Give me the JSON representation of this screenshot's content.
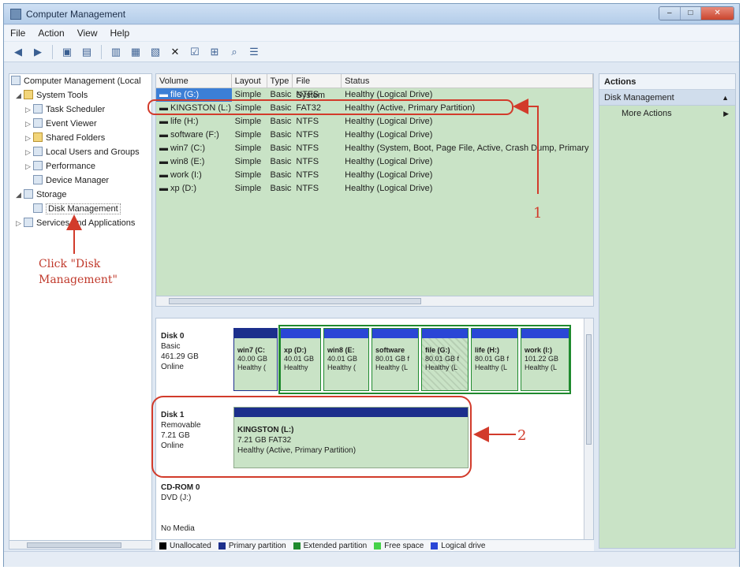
{
  "window": {
    "title": "Computer Management"
  },
  "menu": [
    "File",
    "Action",
    "View",
    "Help"
  ],
  "tree": {
    "root": "Computer Management (Local",
    "items": [
      {
        "label": "System Tools",
        "level": 1
      },
      {
        "label": "Task Scheduler",
        "level": 2
      },
      {
        "label": "Event Viewer",
        "level": 2
      },
      {
        "label": "Shared Folders",
        "level": 2
      },
      {
        "label": "Local Users and Groups",
        "level": 2
      },
      {
        "label": "Performance",
        "level": 2
      },
      {
        "label": "Device Manager",
        "level": 2
      },
      {
        "label": "Storage",
        "level": 1
      },
      {
        "label": "Disk Management",
        "level": 2
      },
      {
        "label": "Services and Applications",
        "level": 1
      }
    ]
  },
  "annotations": {
    "click_line1": "Click  \"Disk",
    "click_line2": "Management\"",
    "marker1": "1",
    "marker2": "2"
  },
  "volume_table": {
    "headers": [
      "Volume",
      "Layout",
      "Type",
      "File System",
      "Status"
    ],
    "rows": [
      [
        "file (G:)",
        "Simple",
        "Basic",
        "NTFS",
        "Healthy (Logical Drive)"
      ],
      [
        "KINGSTON (L:)",
        "Simple",
        "Basic",
        "FAT32",
        "Healthy (Active, Primary Partition)"
      ],
      [
        "life (H:)",
        "Simple",
        "Basic",
        "NTFS",
        "Healthy (Logical Drive)"
      ],
      [
        "software (F:)",
        "Simple",
        "Basic",
        "NTFS",
        "Healthy (Logical Drive)"
      ],
      [
        "win7 (C:)",
        "Simple",
        "Basic",
        "NTFS",
        "Healthy (System, Boot, Page File, Active, Crash Dump, Primary"
      ],
      [
        "win8 (E:)",
        "Simple",
        "Basic",
        "NTFS",
        "Healthy (Logical Drive)"
      ],
      [
        "work (I:)",
        "Simple",
        "Basic",
        "NTFS",
        "Healthy (Logical Drive)"
      ],
      [
        "xp (D:)",
        "Simple",
        "Basic",
        "NTFS",
        "Healthy (Logical Drive)"
      ]
    ]
  },
  "disks": [
    {
      "name": "Disk 0",
      "type": "Basic",
      "size": "461.29 GB",
      "status": "Online"
    },
    {
      "name": "Disk 1",
      "type": "Removable",
      "size": "7.21 GB",
      "status": "Online"
    },
    {
      "name": "CD-ROM 0",
      "type": "DVD (J:)",
      "size": "",
      "status": "No Media"
    }
  ],
  "disk0_partitions": [
    {
      "name": "win7 (C:",
      "size": "40.00 GB",
      "status": "Healthy ("
    },
    {
      "name": "xp (D:)",
      "size": "40.01 GB",
      "status": "Healthy"
    },
    {
      "name": "win8 (E:",
      "size": "40.01 GB",
      "status": "Healthy ("
    },
    {
      "name": "software",
      "size": "80.01 GB f",
      "status": "Healthy (L"
    },
    {
      "name": "file (G:)",
      "size": "80.01 GB f",
      "status": "Healthy (L"
    },
    {
      "name": "life (H:)",
      "size": "80.01 GB f",
      "status": "Healthy (L"
    },
    {
      "name": "work (I:)",
      "size": "101.22 GB",
      "status": "Healthy (L"
    }
  ],
  "disk1_partition": {
    "name": "KINGSTON (L:)",
    "size": "7.21 GB FAT32",
    "status": "Healthy (Active, Primary Partition)"
  },
  "legend": [
    {
      "label": "Unallocated",
      "color": "#000000"
    },
    {
      "label": "Primary partition",
      "color": "#1c2f8c"
    },
    {
      "label": "Extended partition",
      "color": "#1f8a2e"
    },
    {
      "label": "Free space",
      "color": "#46d24a"
    },
    {
      "label": "Logical drive",
      "color": "#2a46d6"
    }
  ],
  "actions": {
    "header": "Actions",
    "section": "Disk Management",
    "more": "More Actions"
  },
  "colors": {
    "annotation": "#d23b2b",
    "volume_bg": "#c9e3c6"
  }
}
